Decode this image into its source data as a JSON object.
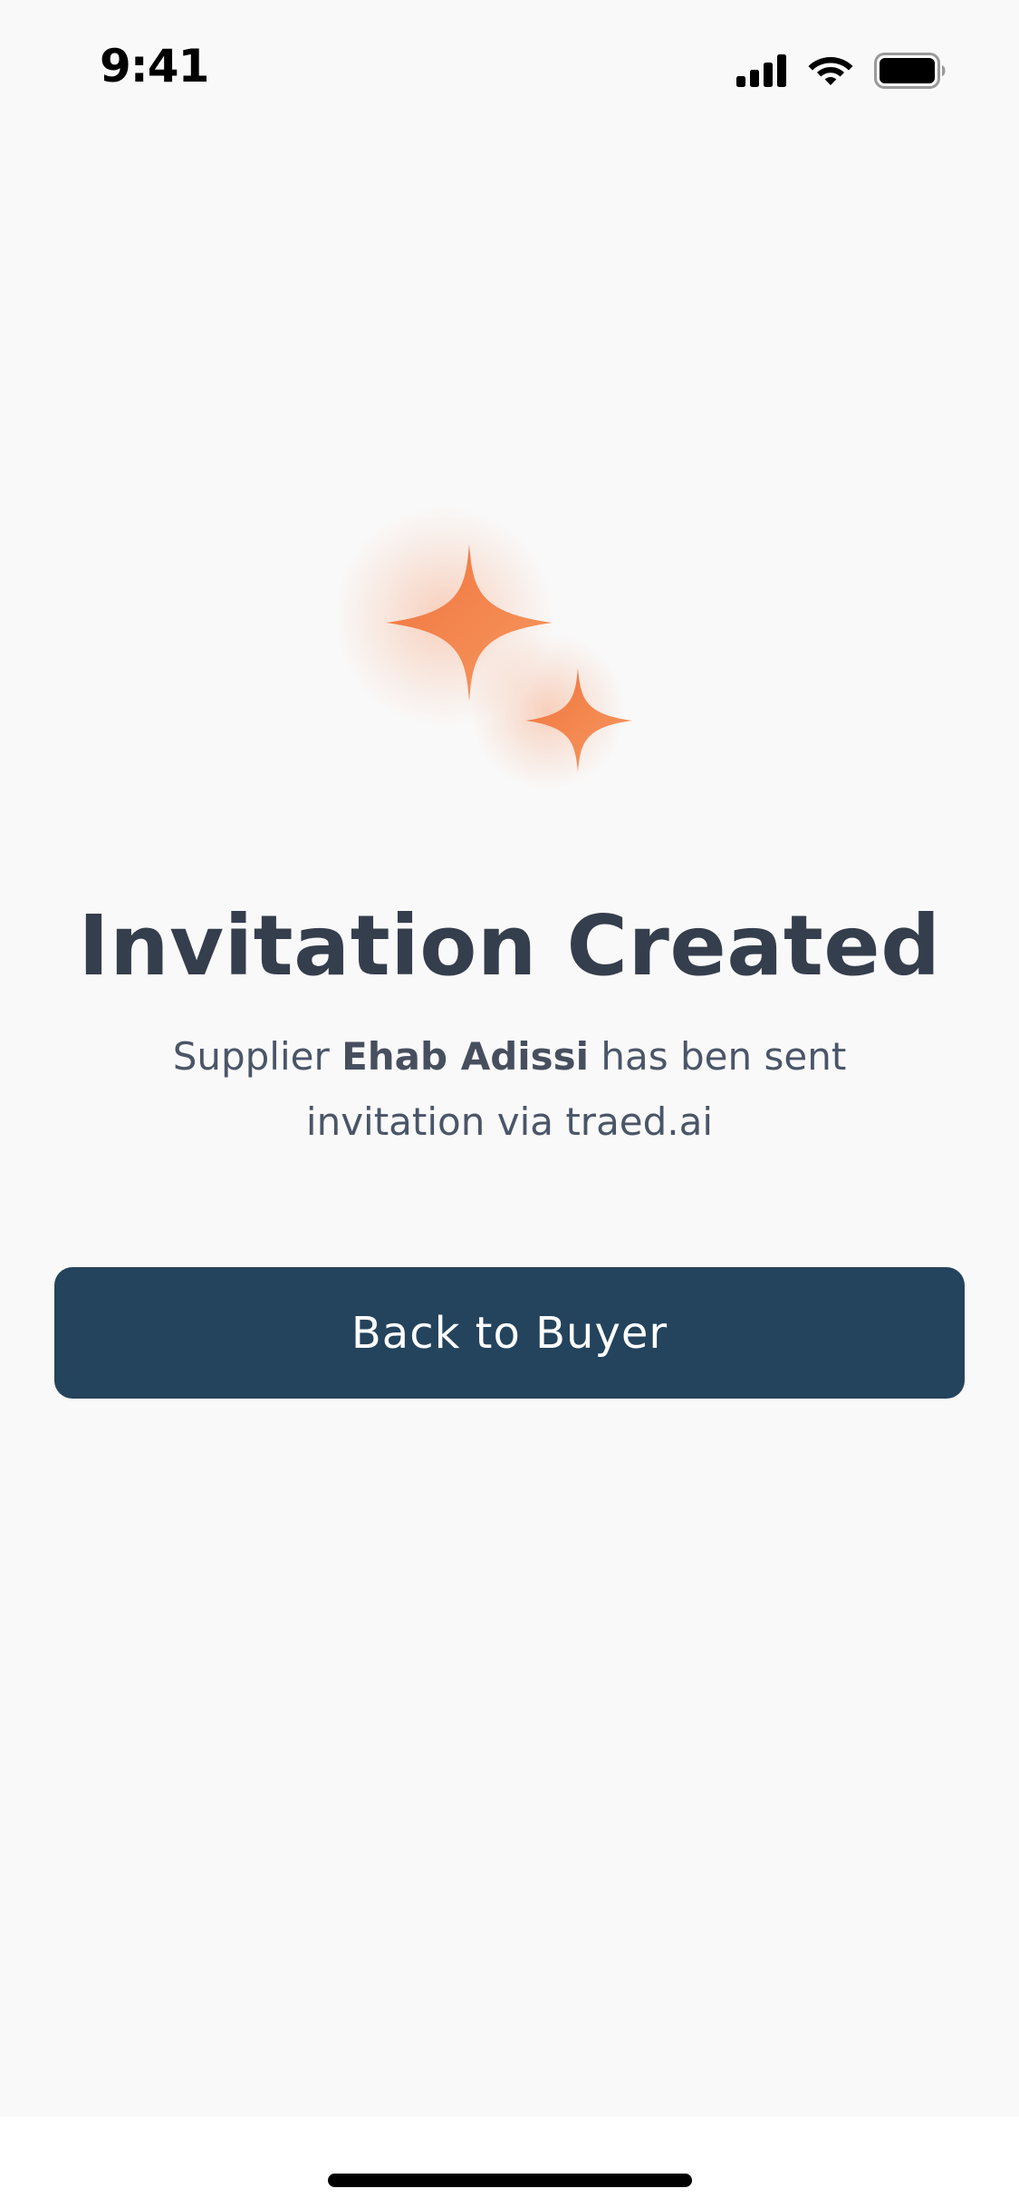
{
  "status_bar": {
    "time": "9:41",
    "icons": [
      "cellular-signal-icon",
      "wifi-icon",
      "battery-icon"
    ]
  },
  "illustration": {
    "icon": "sparkles-icon",
    "color": "#f4824c"
  },
  "confirmation": {
    "title": "Invitation Created",
    "message_prefix": "Supplier ",
    "supplier_name": "Ehab Adissi",
    "message_suffix_line1": " has ben sent",
    "message_line2": "invitation via traed.ai"
  },
  "actions": {
    "back_button_label": "Back to Buyer",
    "button_color": "#24435c"
  },
  "colors": {
    "background": "#f9f9f9",
    "title_text": "#353e4c",
    "body_text": "#4a5568"
  }
}
